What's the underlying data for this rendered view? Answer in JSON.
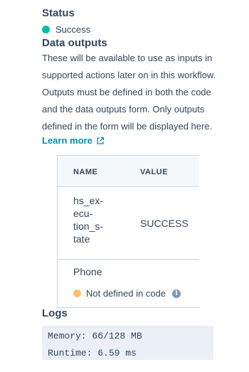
{
  "status": {
    "heading": "Status",
    "value": "Success",
    "dot_color": "#00bda5"
  },
  "data_outputs": {
    "heading": "Data outputs",
    "description_lines": [
      "These will be available to use as inputs in",
      "supported actions later on in this workflow.",
      "Outputs must be defined in both the code",
      "and the data outputs form. Only outputs",
      "defined in the form will be displayed here."
    ],
    "learn_more": "Learn more",
    "learn_more_icon": "external-link-icon",
    "table": {
      "columns": [
        "NAME",
        "VALUE"
      ],
      "rows": [
        {
          "name_lines": [
            "hs_ex-",
            "ecu-",
            "tion_s-",
            "tate"
          ],
          "value": "SUCCESS"
        },
        {
          "name": "Phone",
          "status": "Not defined in code",
          "status_dot_color": "#f5c26b",
          "info_icon": "info-icon"
        }
      ]
    }
  },
  "logs": {
    "heading": "Logs",
    "lines": [
      "Memory: 66/128 MB",
      "Runtime: 6.59 ms"
    ]
  },
  "colors": {
    "text": "#33475b",
    "link": "#0091ae",
    "border": "#cbd6e2",
    "log_bg": "#eaf0f6"
  }
}
